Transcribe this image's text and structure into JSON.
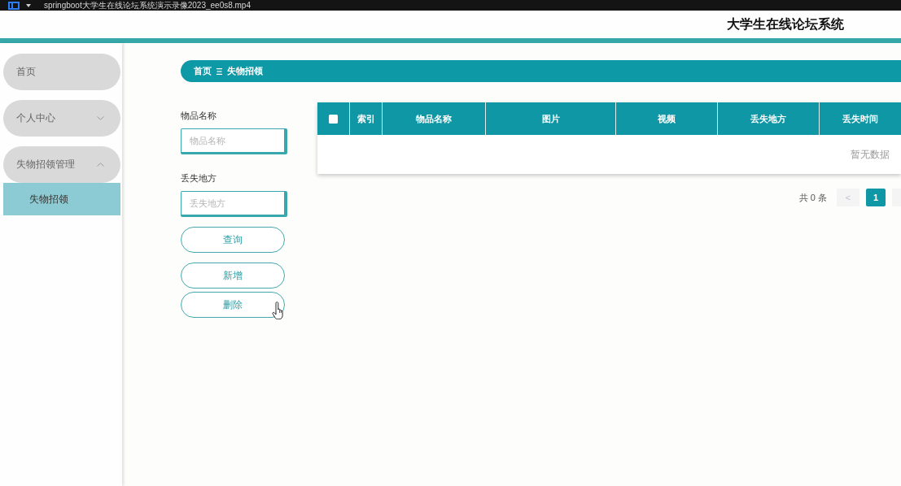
{
  "video_bar": {
    "title": "springboot大学生在线论坛系统演示录像2023_ee0s8.mp4"
  },
  "header": {
    "title": "大学生在线论坛系统"
  },
  "sidebar": {
    "items": [
      {
        "label": "首页",
        "kind": "link"
      },
      {
        "label": "个人中心",
        "kind": "group",
        "expanded": false
      },
      {
        "label": "失物招领管理",
        "kind": "group",
        "expanded": true,
        "children": [
          {
            "label": "失物招领",
            "selected": true
          }
        ]
      }
    ]
  },
  "breadcrumb": {
    "items": [
      "首页",
      "失物招领"
    ]
  },
  "search_form": {
    "fields": [
      {
        "label": "物品名称",
        "placeholder": "物品名称"
      },
      {
        "label": "丢失地方",
        "placeholder": "丢失地方"
      }
    ],
    "buttons": [
      {
        "label": "查询",
        "kind": "search"
      },
      {
        "label": "新增",
        "kind": "add"
      },
      {
        "label": "删除",
        "kind": "delete"
      }
    ]
  },
  "table": {
    "select_all_checked": false,
    "columns": [
      "索引",
      "物品名称",
      "图片",
      "视频",
      "丢失地方",
      "丢失时间"
    ],
    "empty_text": "暂无数据"
  },
  "pagination": {
    "total": "共 0 条",
    "prev": {
      "label": "<",
      "disabled": true
    },
    "pages": [
      {
        "label": "1",
        "selected": true
      }
    ]
  }
}
